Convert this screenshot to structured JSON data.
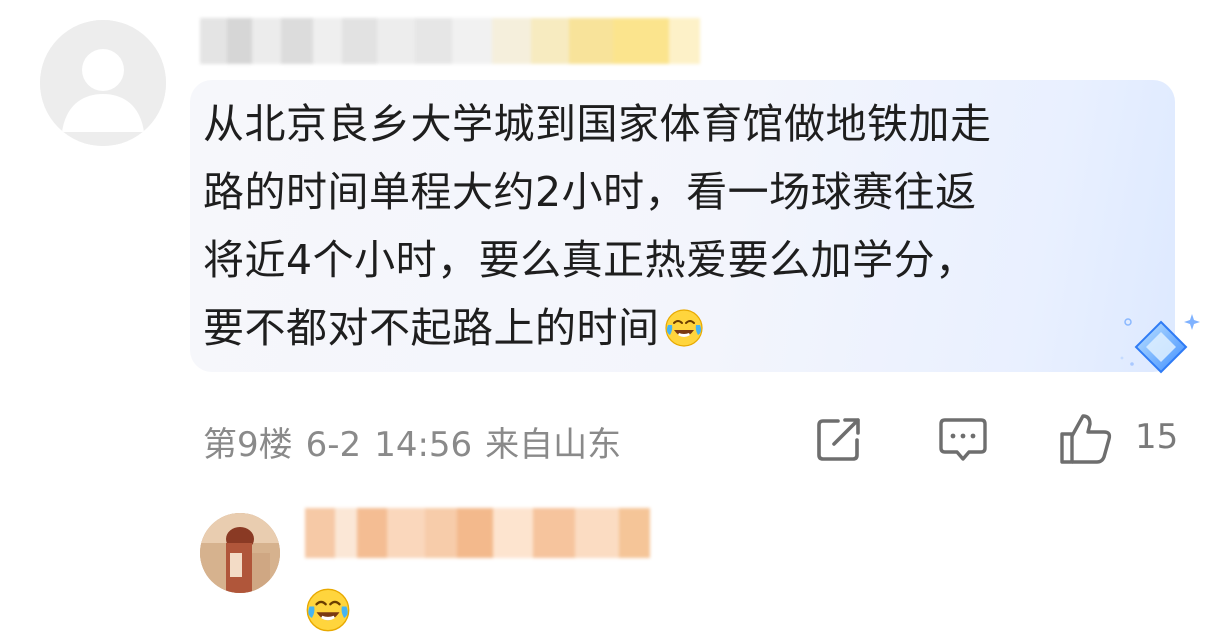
{
  "comment": {
    "text_lines": [
      "从北京良乡大学城到国家体育馆做地铁加走",
      "路的时间单程大约2小时，看一场球赛往返",
      "将近4个小时，要么真正热爱要么加学分，",
      "要不都对不起路上的时间"
    ],
    "trailing_emoji": "laugh-cry-emoji"
  },
  "meta": {
    "floor": "第9楼",
    "date": "6-2",
    "time": "14:56",
    "location": "来自山东"
  },
  "actions": {
    "share_icon": "share-icon",
    "reply_icon": "comment-icon",
    "like_icon": "thumbs-up-icon",
    "like_count": "15"
  },
  "reply": {
    "emoji": "laugh-cry-emoji"
  },
  "colors": {
    "text": "#1e1e1e",
    "meta": "#8a8a8a",
    "bubble": "#f4f6fc",
    "badge": "#5aa0ff"
  }
}
